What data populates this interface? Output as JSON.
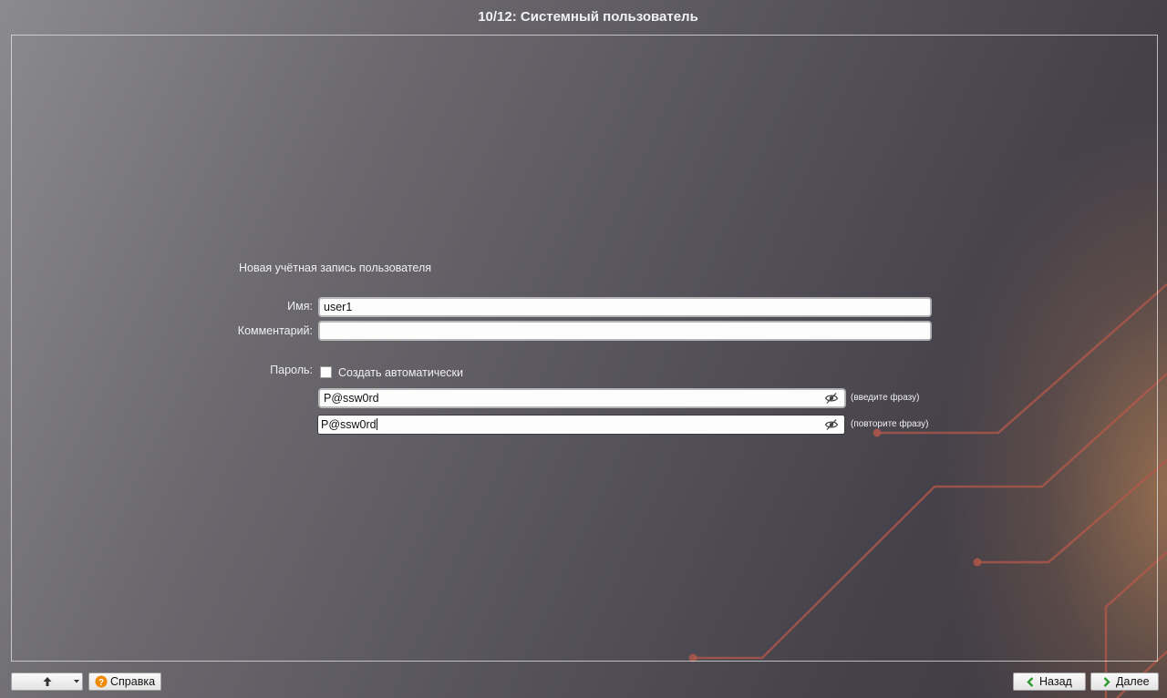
{
  "window": {
    "title": "10/12: Системный пользователь"
  },
  "form": {
    "heading": "Новая учётная запись пользователя",
    "name_label": "Имя:",
    "name_value": "user1",
    "comment_label": "Комментарий:",
    "comment_value": "",
    "password_label": "Пароль:",
    "auto_create_label": "Создать автоматически",
    "auto_create_checked": false,
    "password_value": "P@ssw0rd",
    "password_hint": "(введите фразу)",
    "password_repeat_value": "P@ssw0rd",
    "password_repeat_hint": "(повторите фразу)"
  },
  "footer": {
    "help_label": "Справка",
    "back_label": "Назад",
    "next_label": "Далее"
  },
  "colors": {
    "accent_green": "#2f9a2f",
    "help_orange": "#f08a00",
    "circuit": "#b4584a"
  },
  "icons": [
    "arrow-up-icon",
    "chevron-down-icon",
    "help-icon",
    "eye-slash-icon",
    "chevron-left-icon",
    "chevron-right-icon"
  ]
}
